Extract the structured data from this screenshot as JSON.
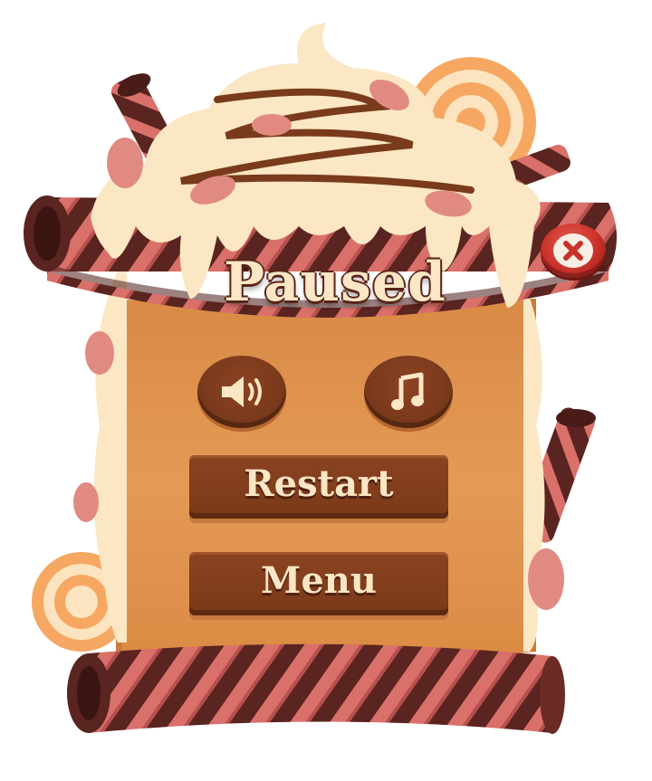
{
  "dialog": {
    "title": "Paused",
    "buttons": {
      "restart_label": "Restart",
      "menu_label": "Menu"
    },
    "icons": {
      "sound": "speaker-icon",
      "music": "music-note-icon",
      "close": "close-icon"
    }
  },
  "colors": {
    "panel": "#e0904a",
    "button": "#7a3a1c",
    "button_text": "#fbe6c6",
    "cream": "#fbe7c4",
    "close_red": "#c9322a",
    "stripe_dark": "#4e1f1c",
    "stripe_light": "#d76a64"
  }
}
